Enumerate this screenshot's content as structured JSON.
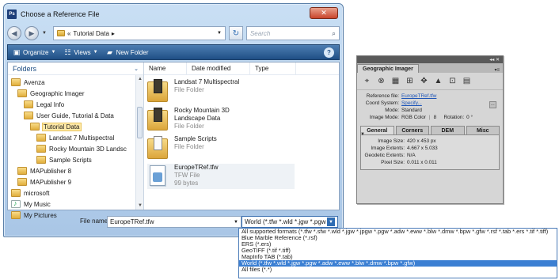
{
  "dialog": {
    "title": "Choose a Reference File",
    "title_icon": "Ps",
    "close_label": "✕",
    "address": {
      "prefix": "«",
      "path": "Tutorial Data",
      "separator": "▸"
    },
    "search_placeholder": "Search",
    "toolbar": {
      "organize": "Organize",
      "views": "Views",
      "new_folder": "New Folder"
    },
    "folders_header": "Folders",
    "tree": [
      {
        "label": "Avenza",
        "indent": 0,
        "icon": "folder-icon"
      },
      {
        "label": "Geographic Imager",
        "indent": 1,
        "icon": "folder-icon"
      },
      {
        "label": "Legal Info",
        "indent": 2,
        "icon": "folder-icon"
      },
      {
        "label": "User Guide, Tutorial & Data",
        "indent": 2,
        "icon": "folder-icon"
      },
      {
        "label": "Tutorial Data",
        "indent": 3,
        "icon": "folder-icon",
        "selected": true
      },
      {
        "label": "Landsat 7 Multispectral",
        "indent": 4,
        "icon": "folder-icon"
      },
      {
        "label": "Rocky Mountain 3D Landsc",
        "indent": 4,
        "icon": "folder-icon"
      },
      {
        "label": "Sample Scripts",
        "indent": 4,
        "icon": "folder-icon"
      },
      {
        "label": "MAPublisher 8",
        "indent": 1,
        "icon": "folder-icon"
      },
      {
        "label": "MAPublisher 9",
        "indent": 1,
        "icon": "folder-icon"
      },
      {
        "label": "microsoft",
        "indent": 0,
        "icon": "folder-icon"
      },
      {
        "label": "My Music",
        "indent": 0,
        "icon": "music-icon"
      },
      {
        "label": "My Pictures",
        "indent": 0,
        "icon": "folder-icon"
      }
    ],
    "columns": [
      "Name",
      "Date modified",
      "Type"
    ],
    "files": [
      {
        "name": "Landsat 7 Multispectral",
        "line2": "",
        "type": "File Folder",
        "size": "",
        "icon": "folder-dark"
      },
      {
        "name": "Rocky Mountain 3D",
        "line2": "Landscape Data",
        "type": "File Folder",
        "size": "",
        "icon": "folder-dark"
      },
      {
        "name": "Sample Scripts",
        "line2": "",
        "type": "File Folder",
        "size": "",
        "icon": "folder-light"
      },
      {
        "name": "EuropeTRef.tfw",
        "line2": "",
        "type": "TFW File",
        "size": "99 bytes",
        "icon": "document"
      }
    ],
    "file_name_label": "File name:",
    "file_name_value": "EuropeTRef.tfw",
    "filter_value": "World (*.tfw *.wld *.jgw *.pgw *.adw *.eww *.blw *.dmw *.bpw *.gfw)"
  },
  "dropdown": [
    "All supported formats (*.tfw *.sfw *.wld *.jgw *.jpgw *.pgw *.adw *.eww *.blw *.dmw *.bpw *.gfw *.rsf *.tab *.ers *.tif *.tiff)",
    "Blue Marble Reference (*.rsf)",
    "ERS (*.ers)",
    "GeoTIFF (*.tif *.tiff)",
    "MapInfo TAB (*.tab)",
    "World (*.tfw *.wld *.jgw *.pgw *.adw *.eww *.blw *.dmw *.bpw *.gfw)",
    "All files (*.*)"
  ],
  "dropdown_selected_index": 5,
  "panel": {
    "topbar": "◂◂ ✕",
    "tab": "Geographic Imager",
    "menu": "▾≡",
    "tools": [
      "georeference-icon",
      "transform-icon",
      "tile-icon",
      "mosaic-icon",
      "reproject-icon",
      "terrain-icon",
      "clip-icon",
      "table-icon"
    ],
    "reference_label": "Reference file:",
    "reference_value": "EuropeTRef.tfw",
    "coord_label": "Coord System:",
    "coord_value": "Specify...",
    "mode_label": "Mode:",
    "mode_value": "Standard",
    "image_mode_label": "Image Mode:",
    "image_mode_value": "RGB Color",
    "image_mode_bits": "8",
    "rotation_label": "Rotation:",
    "rotation_value": "0 °",
    "inner_tabs": [
      "General",
      "Corners",
      "DEM",
      "Misc"
    ],
    "general": [
      {
        "k": "Image Size:",
        "v": "420 x 453 px"
      },
      {
        "k": "Image Extents:",
        "v": "4.667 x 5.033"
      },
      {
        "k": "Geodetic Extents:",
        "v": "N/A"
      },
      {
        "k": "Pixel Size:",
        "v": "0.011 x 0.011"
      }
    ]
  }
}
